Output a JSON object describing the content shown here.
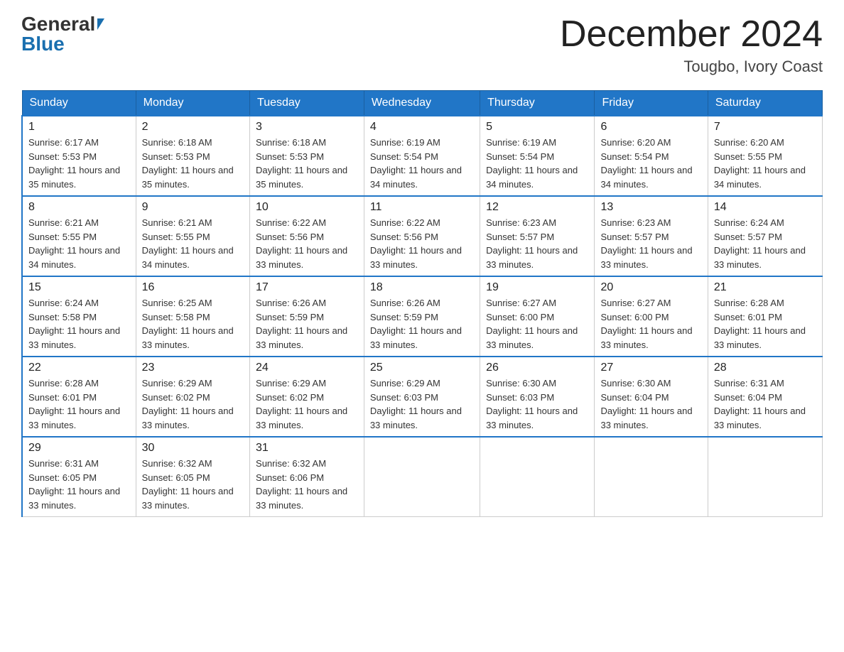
{
  "header": {
    "logo_general": "General",
    "logo_blue": "Blue",
    "month_title": "December 2024",
    "location": "Tougbo, Ivory Coast"
  },
  "days_of_week": [
    "Sunday",
    "Monday",
    "Tuesday",
    "Wednesday",
    "Thursday",
    "Friday",
    "Saturday"
  ],
  "weeks": [
    [
      {
        "day": "1",
        "sunrise": "6:17 AM",
        "sunset": "5:53 PM",
        "daylight": "11 hours and 35 minutes."
      },
      {
        "day": "2",
        "sunrise": "6:18 AM",
        "sunset": "5:53 PM",
        "daylight": "11 hours and 35 minutes."
      },
      {
        "day": "3",
        "sunrise": "6:18 AM",
        "sunset": "5:53 PM",
        "daylight": "11 hours and 35 minutes."
      },
      {
        "day": "4",
        "sunrise": "6:19 AM",
        "sunset": "5:54 PM",
        "daylight": "11 hours and 34 minutes."
      },
      {
        "day": "5",
        "sunrise": "6:19 AM",
        "sunset": "5:54 PM",
        "daylight": "11 hours and 34 minutes."
      },
      {
        "day": "6",
        "sunrise": "6:20 AM",
        "sunset": "5:54 PM",
        "daylight": "11 hours and 34 minutes."
      },
      {
        "day": "7",
        "sunrise": "6:20 AM",
        "sunset": "5:55 PM",
        "daylight": "11 hours and 34 minutes."
      }
    ],
    [
      {
        "day": "8",
        "sunrise": "6:21 AM",
        "sunset": "5:55 PM",
        "daylight": "11 hours and 34 minutes."
      },
      {
        "day": "9",
        "sunrise": "6:21 AM",
        "sunset": "5:55 PM",
        "daylight": "11 hours and 34 minutes."
      },
      {
        "day": "10",
        "sunrise": "6:22 AM",
        "sunset": "5:56 PM",
        "daylight": "11 hours and 33 minutes."
      },
      {
        "day": "11",
        "sunrise": "6:22 AM",
        "sunset": "5:56 PM",
        "daylight": "11 hours and 33 minutes."
      },
      {
        "day": "12",
        "sunrise": "6:23 AM",
        "sunset": "5:57 PM",
        "daylight": "11 hours and 33 minutes."
      },
      {
        "day": "13",
        "sunrise": "6:23 AM",
        "sunset": "5:57 PM",
        "daylight": "11 hours and 33 minutes."
      },
      {
        "day": "14",
        "sunrise": "6:24 AM",
        "sunset": "5:57 PM",
        "daylight": "11 hours and 33 minutes."
      }
    ],
    [
      {
        "day": "15",
        "sunrise": "6:24 AM",
        "sunset": "5:58 PM",
        "daylight": "11 hours and 33 minutes."
      },
      {
        "day": "16",
        "sunrise": "6:25 AM",
        "sunset": "5:58 PM",
        "daylight": "11 hours and 33 minutes."
      },
      {
        "day": "17",
        "sunrise": "6:26 AM",
        "sunset": "5:59 PM",
        "daylight": "11 hours and 33 minutes."
      },
      {
        "day": "18",
        "sunrise": "6:26 AM",
        "sunset": "5:59 PM",
        "daylight": "11 hours and 33 minutes."
      },
      {
        "day": "19",
        "sunrise": "6:27 AM",
        "sunset": "6:00 PM",
        "daylight": "11 hours and 33 minutes."
      },
      {
        "day": "20",
        "sunrise": "6:27 AM",
        "sunset": "6:00 PM",
        "daylight": "11 hours and 33 minutes."
      },
      {
        "day": "21",
        "sunrise": "6:28 AM",
        "sunset": "6:01 PM",
        "daylight": "11 hours and 33 minutes."
      }
    ],
    [
      {
        "day": "22",
        "sunrise": "6:28 AM",
        "sunset": "6:01 PM",
        "daylight": "11 hours and 33 minutes."
      },
      {
        "day": "23",
        "sunrise": "6:29 AM",
        "sunset": "6:02 PM",
        "daylight": "11 hours and 33 minutes."
      },
      {
        "day": "24",
        "sunrise": "6:29 AM",
        "sunset": "6:02 PM",
        "daylight": "11 hours and 33 minutes."
      },
      {
        "day": "25",
        "sunrise": "6:29 AM",
        "sunset": "6:03 PM",
        "daylight": "11 hours and 33 minutes."
      },
      {
        "day": "26",
        "sunrise": "6:30 AM",
        "sunset": "6:03 PM",
        "daylight": "11 hours and 33 minutes."
      },
      {
        "day": "27",
        "sunrise": "6:30 AM",
        "sunset": "6:04 PM",
        "daylight": "11 hours and 33 minutes."
      },
      {
        "day": "28",
        "sunrise": "6:31 AM",
        "sunset": "6:04 PM",
        "daylight": "11 hours and 33 minutes."
      }
    ],
    [
      {
        "day": "29",
        "sunrise": "6:31 AM",
        "sunset": "6:05 PM",
        "daylight": "11 hours and 33 minutes."
      },
      {
        "day": "30",
        "sunrise": "6:32 AM",
        "sunset": "6:05 PM",
        "daylight": "11 hours and 33 minutes."
      },
      {
        "day": "31",
        "sunrise": "6:32 AM",
        "sunset": "6:06 PM",
        "daylight": "11 hours and 33 minutes."
      },
      null,
      null,
      null,
      null
    ]
  ]
}
